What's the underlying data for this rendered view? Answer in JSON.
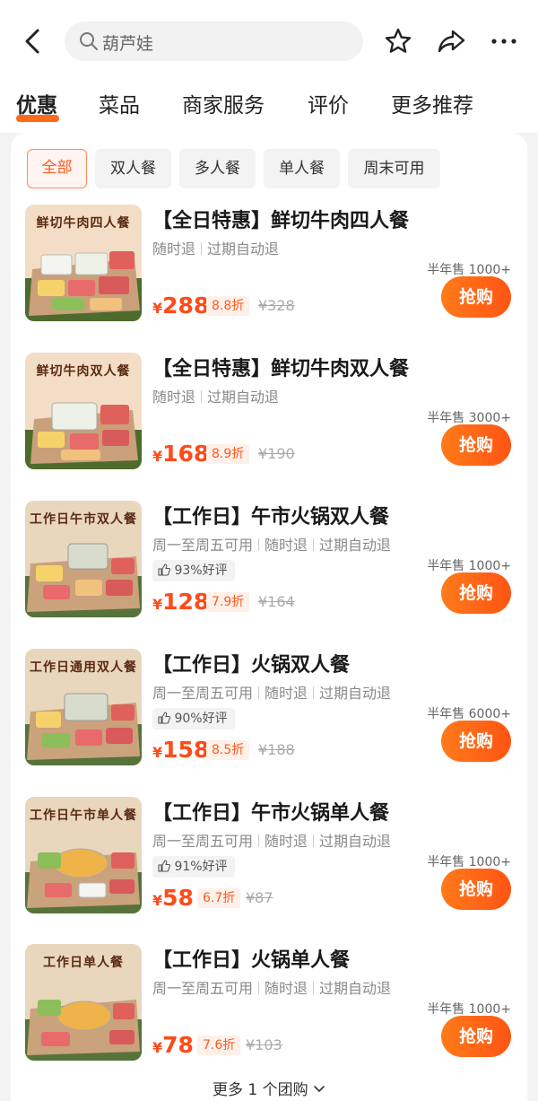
{
  "search": {
    "placeholder": "葫芦娃"
  },
  "tabs": [
    {
      "label": "优惠"
    },
    {
      "label": "菜品"
    },
    {
      "label": "商家服务"
    },
    {
      "label": "评价"
    },
    {
      "label": "更多推荐"
    }
  ],
  "filters": [
    {
      "label": "全部"
    },
    {
      "label": "双人餐"
    },
    {
      "label": "多人餐"
    },
    {
      "label": "单人餐"
    },
    {
      "label": "周末可用"
    }
  ],
  "deals": [
    {
      "thumb_title": "鲜切牛肉四人餐",
      "title": "【全日特惠】鲜切牛肉四人餐",
      "tags": [
        "随时退",
        "过期自动退"
      ],
      "rating": "",
      "sold": "半年售 1000+",
      "currency": "¥",
      "price": "288",
      "discount": "8.8折",
      "original": "¥328",
      "buy": "抢购"
    },
    {
      "thumb_title": "鲜切牛肉双人餐",
      "title": "【全日特惠】鲜切牛肉双人餐",
      "tags": [
        "随时退",
        "过期自动退"
      ],
      "rating": "",
      "sold": "半年售 3000+",
      "currency": "¥",
      "price": "168",
      "discount": "8.9折",
      "original": "¥190",
      "buy": "抢购"
    },
    {
      "thumb_title": "工作日午市双人餐",
      "title": "【工作日】午市火锅双人餐",
      "tags": [
        "周一至周五可用",
        "随时退",
        "过期自动退"
      ],
      "rating": "93%好评",
      "sold": "半年售 1000+",
      "currency": "¥",
      "price": "128",
      "discount": "7.9折",
      "original": "¥164",
      "buy": "抢购"
    },
    {
      "thumb_title": "工作日通用双人餐",
      "title": "【工作日】火锅双人餐",
      "tags": [
        "周一至周五可用",
        "随时退",
        "过期自动退"
      ],
      "rating": "90%好评",
      "sold": "半年售 6000+",
      "currency": "¥",
      "price": "158",
      "discount": "8.5折",
      "original": "¥188",
      "buy": "抢购"
    },
    {
      "thumb_title": "工作日午市单人餐",
      "title": "【工作日】午市火锅单人餐",
      "tags": [
        "周一至周五可用",
        "随时退",
        "过期自动退"
      ],
      "rating": "91%好评",
      "sold": "半年售 1000+",
      "currency": "¥",
      "price": "58",
      "discount": "6.7折",
      "original": "¥87",
      "buy": "抢购"
    },
    {
      "thumb_title": "工作日单人餐",
      "title": "【工作日】火锅单人餐",
      "tags": [
        "周一至周五可用",
        "随时退",
        "过期自动退"
      ],
      "rating": "",
      "sold": "半年售 1000+",
      "currency": "¥",
      "price": "78",
      "discount": "7.6折",
      "original": "¥103",
      "buy": "抢购"
    }
  ],
  "more": {
    "label": "更多 1 个团购"
  },
  "icons": {
    "back": "back-arrow-icon",
    "search": "search-icon",
    "favorite": "star-icon",
    "share": "share-icon",
    "menu": "more-dots-icon",
    "like": "thumbs-up-icon",
    "expand": "chevron-down-icon"
  },
  "colors": {
    "accent": "#ff5a1f",
    "price": "#ff4a1a"
  }
}
